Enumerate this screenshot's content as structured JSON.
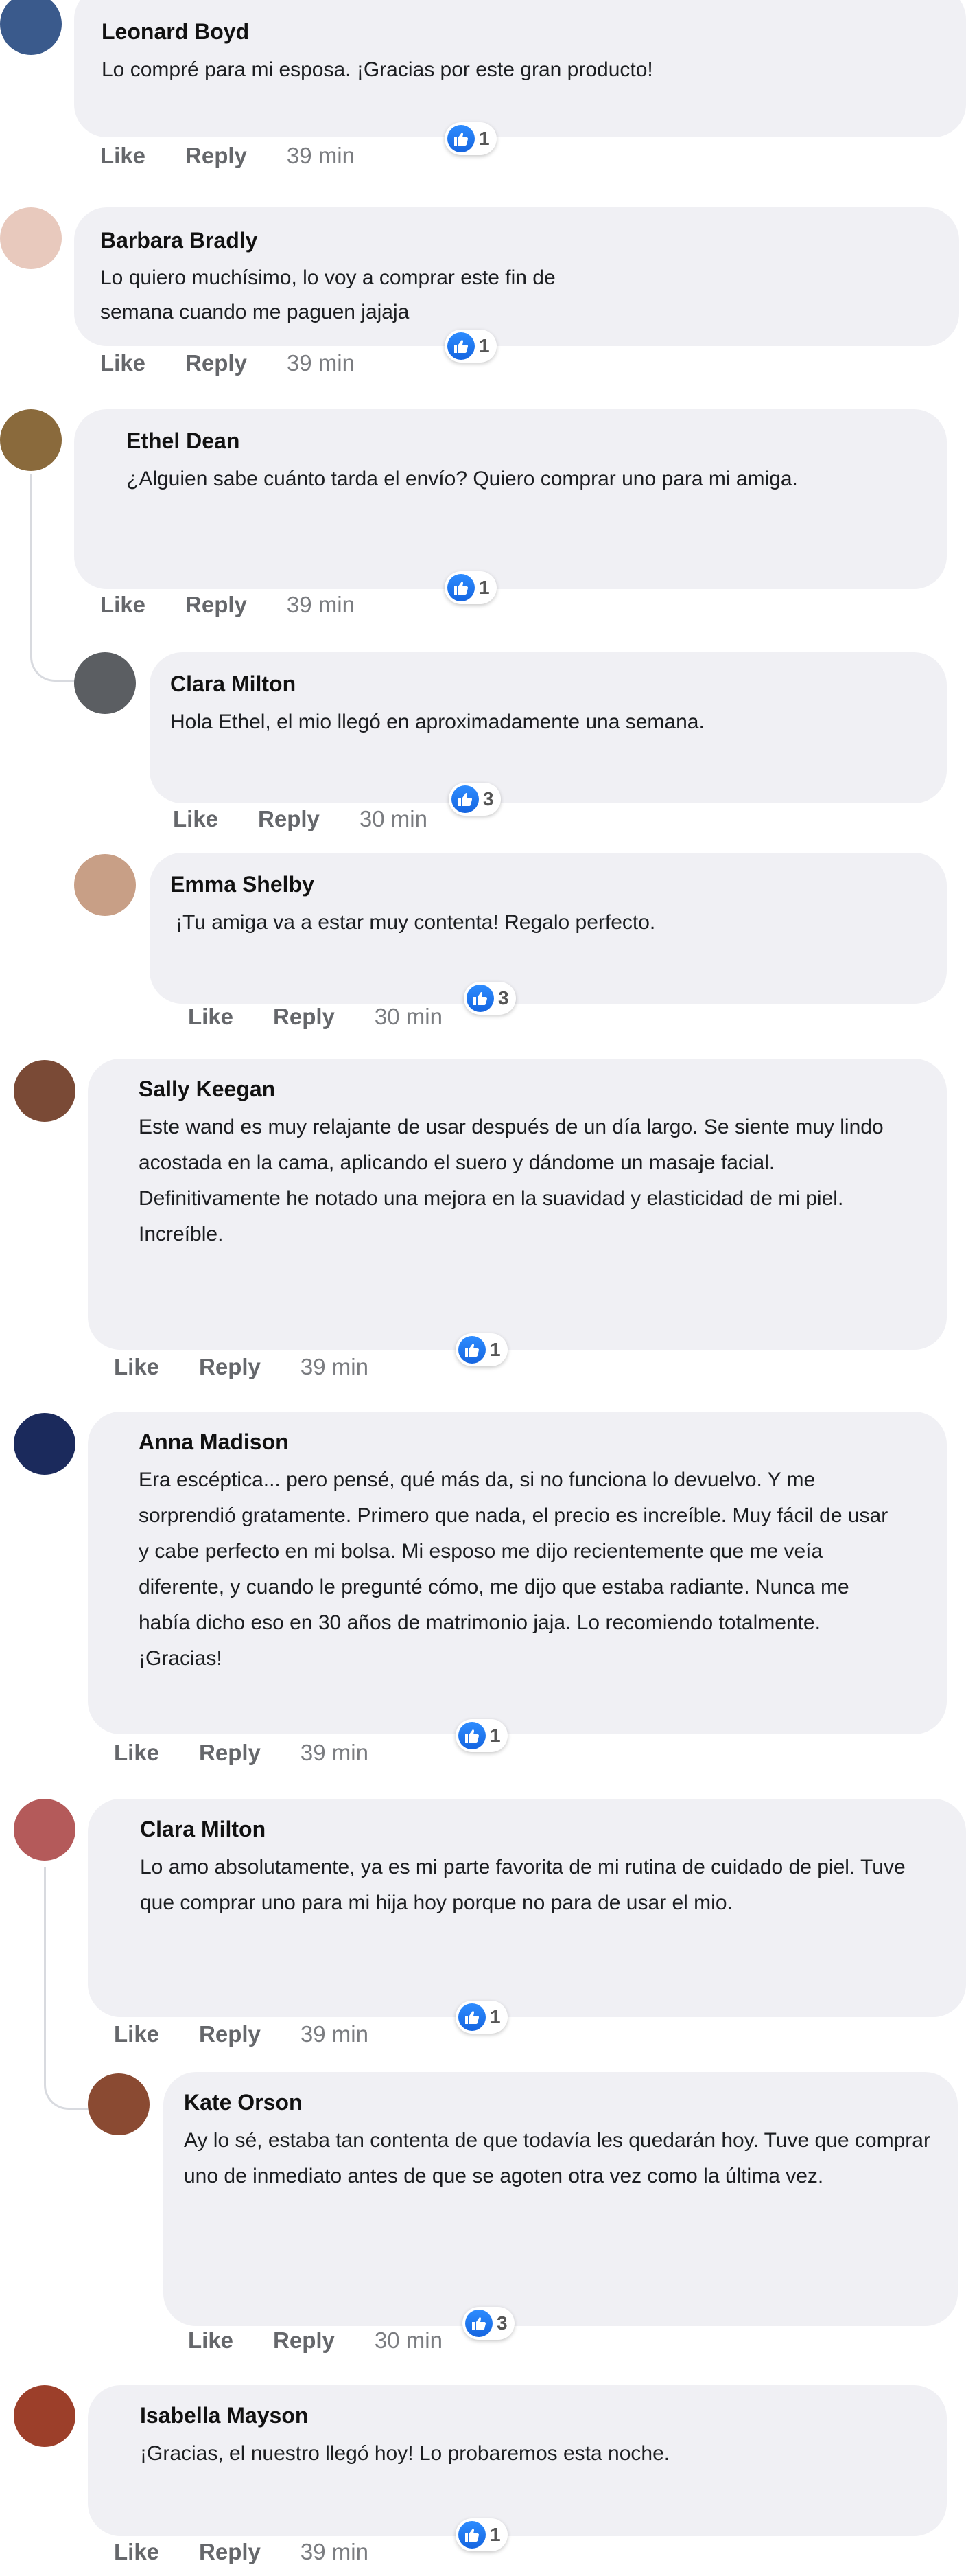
{
  "ui": {
    "like_label": "Like",
    "reply_label": "Reply"
  },
  "comments": [
    {
      "name": "Leonard Boyd",
      "text": "Lo compré para mi esposa. ¡Gracias por este gran producto!",
      "reactions": "1",
      "time": "39 min",
      "avatar_color": "#3a5a8c"
    },
    {
      "name": "Barbara Bradly",
      "text": "Lo quiero muchísimo, lo voy a comprar este fin de semana cuando me paguen jajaja",
      "reactions": "1",
      "time": "39 min",
      "avatar_color": "#e8c9bd"
    },
    {
      "name": "Ethel Dean",
      "text": "¿Alguien sabe cuánto tarda el envío? Quiero comprar uno para mi amiga.",
      "reactions": "1",
      "time": "39 min",
      "avatar_color": "#8a6a3c"
    },
    {
      "name": "Clara Milton",
      "text": "Hola Ethel, el mio llegó en aproximadamente una semana.",
      "reactions": "3",
      "time": "30 min",
      "avatar_color": "#5b5e62"
    },
    {
      "name": "Emma Shelby",
      "text": "¡Tu amiga va a estar muy contenta! Regalo perfecto.",
      "reactions": "3",
      "time": "30 min",
      "avatar_color": "#c89f86"
    },
    {
      "name": "Sally Keegan",
      "text": "Este wand es muy relajante de usar después de un día largo. Se siente muy lindo acostada en la cama, aplicando el suero y dándome un masaje facial. Definitivamente he notado una mejora en la suavidad y elasticidad de mi piel. Increíble.",
      "reactions": "1",
      "time": "39 min",
      "avatar_color": "#7a4a36"
    },
    {
      "name": "Anna Madison",
      "text": "Era escéptica... pero pensé, qué más da, si no funciona lo devuelvo. Y me sorprendió gratamente. Primero que nada, el precio es increíble. Muy fácil de usar y cabe perfecto en mi bolsa. Mi esposo me dijo recientemente que me veía diferente, y cuando le pregunté cómo, me dijo que estaba radiante. Nunca me había dicho eso en 30 años de matrimonio jaja. Lo recomiendo totalmente. ¡Gracias!",
      "reactions": "1",
      "time": "39 min",
      "avatar_color": "#1b2a5c"
    },
    {
      "name": "Clara Milton",
      "text": "Lo amo absolutamente, ya es mi parte favorita de mi rutina de cuidado de piel. Tuve que comprar uno para mi hija hoy porque no para de usar el mio.",
      "reactions": "1",
      "time": "39 min",
      "avatar_color": "#b45a5a"
    },
    {
      "name": "Kate Orson",
      "text": "Ay lo sé, estaba tan contenta de que todavía les quedarán hoy. Tuve que comprar uno de inmediato antes de que se agoten otra vez como la última vez.",
      "reactions": "3",
      "time": "30 min",
      "avatar_color": "#8a4a32"
    },
    {
      "name": "Isabella Mayson",
      "text": "¡Gracias, el nuestro llegó hoy! Lo probaremos esta noche.",
      "reactions": "1",
      "time": "39 min",
      "avatar_color": "#9c3f2a"
    }
  ]
}
